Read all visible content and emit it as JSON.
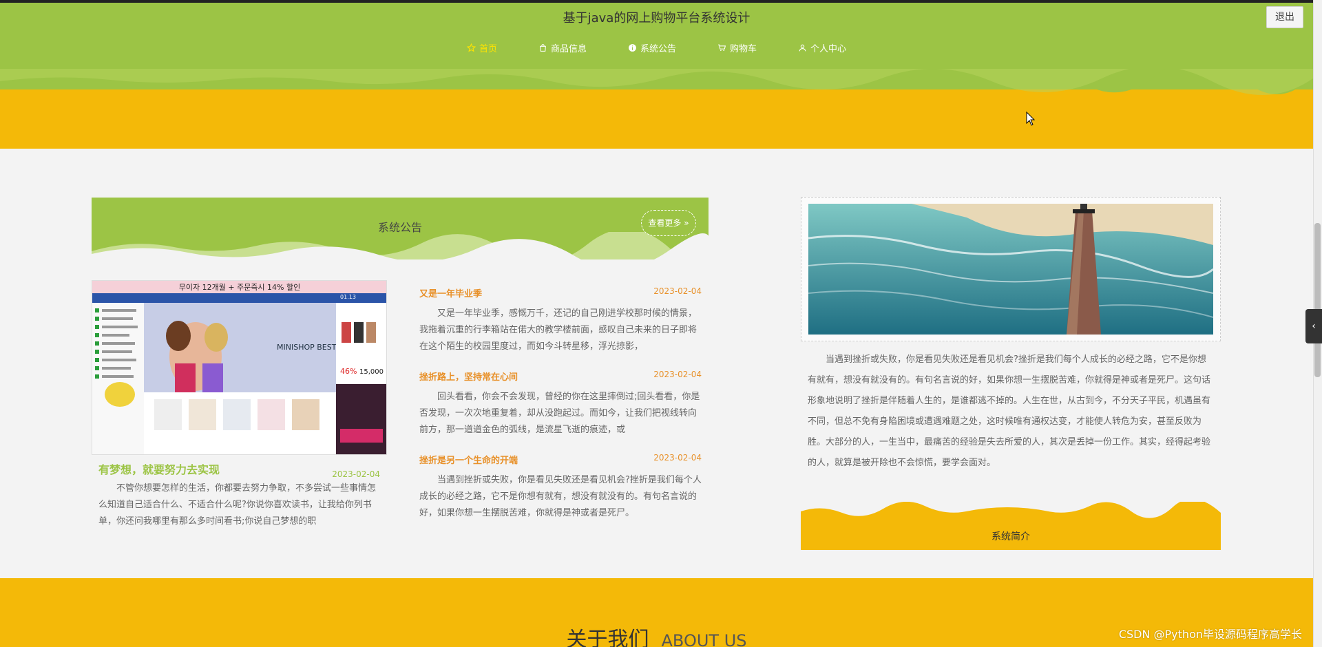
{
  "header": {
    "title": "基于java的网上购物平台系统设计",
    "logout_label": "退出",
    "nav": [
      {
        "label": "首页",
        "icon": "star-icon",
        "active": true
      },
      {
        "label": "商品信息",
        "icon": "bag-icon",
        "active": false
      },
      {
        "label": "系统公告",
        "icon": "info-icon",
        "active": false
      },
      {
        "label": "购物车",
        "icon": "cart-icon",
        "active": false
      },
      {
        "label": "个人中心",
        "icon": "user-icon",
        "active": false
      }
    ]
  },
  "notice": {
    "section_title": "系统公告",
    "more_label": "查看更多 »",
    "featured": {
      "title": "有梦想，就要努力去实现",
      "date": "2023-02-04",
      "summary": "不管你想要怎样的生活，你都要去努力争取，不多尝试一些事情怎么知道自己适合什么、不适合什么呢?你说你喜欢读书，让我给你列书单，你还问我哪里有那么多时间看书;你说自己梦想的职"
    },
    "featured_image": {
      "top_banner": "무이자 12개월 + 주문즉시 14% 할인",
      "brand": "MINISHOP BEST",
      "discount": "46%",
      "price": "15,000",
      "date_tag": "01.13"
    },
    "items": [
      {
        "title": "又是一年毕业季",
        "date": "2023-02-04",
        "summary": "又是一年毕业季，感慨万千，还记的自己刚进学校那时候的情景，我拖着沉重的行李箱站在偌大的教学楼前面，感叹自己未来的日子即将在这个陌生的校园里度过，而如今斗转星移，浮光掠影，"
      },
      {
        "title": "挫折路上，坚持常在心间",
        "date": "2023-02-04",
        "summary": "回头看看，你会不会发现，曾经的你在这里摔倒过;回头看看，你是否发现，一次次地重复着，却从没跑起过。而如今，让我们把视线转向前方，那一道道金色的弧线，是流星飞逝的痕迹，或"
      },
      {
        "title": "挫折是另一个生命的开端",
        "date": "2023-02-04",
        "summary": "当遇到挫折或失败，你是看见失败还是看见机会?挫折是我们每个人成长的必经之路，它不是你想有就有，想没有就没有的。有句名言说的好，如果你想一生摆脱苦难，你就得是神或者是死尸。"
      }
    ]
  },
  "intro": {
    "text": "当遇到挫折或失败，你是看见失败还是看见机会?挫折是我们每个人成长的必经之路，它不是你想有就有，想没有就没有的。有句名言说的好，如果你想一生摆脱苦难，你就得是神或者是死尸。这句话形象地说明了挫折是伴随着人生的，是谁都逃不掉的。人生在世，从古到今，不分天子平民，机遇虽有不同，但总不免有身陷困境或遭遇难题之处，这时候唯有通权达变，才能使人转危为安，甚至反败为胜。大部分的人，一生当中，最痛苦的经验是失去所爱的人，其次是丢掉一份工作。其实，经得起考验的人，就算是被开除也不会惊慌，要学会面对。",
    "banner_title": "系统简介"
  },
  "about": {
    "title_cn": "关于我们",
    "title_en": "ABOUT US"
  },
  "watermark": "CSDN @Python毕设源码程序高学长",
  "side_toggle_label": "‹",
  "colors": {
    "green": "#9cc445",
    "yellow": "#f4b908",
    "orange": "#e8912a",
    "nav_active": "#ffe400"
  }
}
